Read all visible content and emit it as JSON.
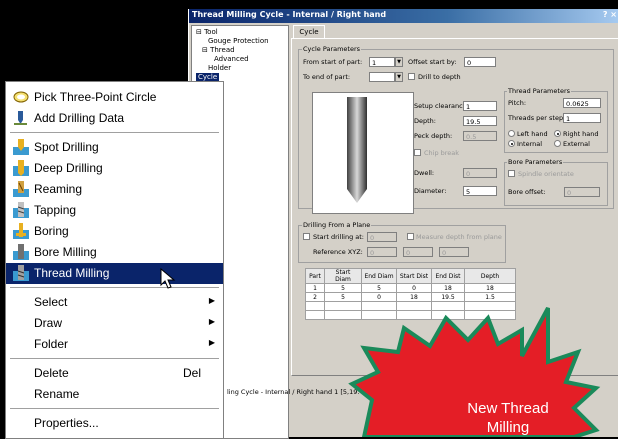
{
  "dialog": {
    "title": "Thread Milling Cycle - Internal / Right hand",
    "title_controls": "? ×",
    "tab_cycle": "Cycle",
    "tree": [
      {
        "label": "Tool"
      },
      {
        "label": "Gouge Protection"
      },
      {
        "label": "Thread"
      },
      {
        "label": "Advanced"
      },
      {
        "label": "Holder"
      },
      {
        "label": "Cycle",
        "selected": true
      }
    ],
    "cycle_parameters": {
      "group_title": "Cycle Parameters",
      "from_start_label": "From start of part:",
      "from_start_value": "1",
      "to_end_label": "To end of part:",
      "to_end_value": "",
      "offset_label": "Offset start by:",
      "offset_value": "0",
      "drill_to_depth_label": "Drill to depth",
      "setup_clearance_label": "Setup clearance:",
      "setup_clearance_value": "1",
      "depth_label": "Depth:",
      "depth_value": "19.5",
      "peck_depth_label": "Peck depth:",
      "peck_depth_value": "0.5",
      "chip_break_label": "Chip break",
      "dwell_label": "Dwell:",
      "dwell_value": "0",
      "diameter_label": "Diameter:",
      "diameter_value": "5"
    },
    "thread_parameters": {
      "group_title": "Thread Parameters",
      "pitch_label": "Pitch:",
      "pitch_value": "0.0625",
      "threads_per_step_label": "Threads per step:",
      "threads_per_step_value": "1",
      "left_hand_label": "Left hand",
      "right_hand_label": "Right hand",
      "internal_label": "Internal",
      "external_label": "External"
    },
    "bore_parameters": {
      "group_title": "Bore Parameters",
      "spindle_orientate_label": "Spindle orientate",
      "bore_offset_label": "Bore offset:",
      "bore_offset_value": "0"
    },
    "drilling_plane": {
      "group_title": "Drilling From a Plane",
      "start_drilling_label": "Start drilling at:",
      "start_drilling_value": "0",
      "measure_label": "Measure depth from plane",
      "reference_label": "Reference XYZ:",
      "ref_x": "0",
      "ref_y": "0",
      "ref_z": "0"
    },
    "table": {
      "headers": [
        "Part",
        "Start Diam",
        "End Diam",
        "Start Dist",
        "End Dist",
        "Depth"
      ],
      "rows": [
        [
          "1",
          "5",
          "5",
          "0",
          "18",
          "18"
        ],
        [
          "2",
          "5",
          "0",
          "18",
          "19.5",
          "1.5"
        ]
      ]
    },
    "statusbar": "ling Cycle - Internal / Right hand 1 [5,19."
  },
  "menu": {
    "items": [
      {
        "label": "Pick Three-Point Circle",
        "icon": "circle-icon"
      },
      {
        "label": "Add Drilling Data",
        "icon": "add-drill-icon"
      },
      {
        "label": "Spot Drilling",
        "icon": "spot-drill-icon"
      },
      {
        "label": "Deep Drilling",
        "icon": "deep-drill-icon"
      },
      {
        "label": "Reaming",
        "icon": "ream-icon"
      },
      {
        "label": "Tapping",
        "icon": "tap-icon"
      },
      {
        "label": "Boring",
        "icon": "bore-icon"
      },
      {
        "label": "Bore Milling",
        "icon": "bore-mill-icon"
      },
      {
        "label": "Thread Milling",
        "icon": "thread-mill-icon",
        "highlighted": true
      },
      {
        "label": "Select",
        "submenu": true
      },
      {
        "label": "Draw",
        "submenu": true
      },
      {
        "label": "Folder",
        "submenu": true
      },
      {
        "label": "Delete",
        "shortcut": "Del"
      },
      {
        "label": "Rename"
      },
      {
        "label": "Properties..."
      }
    ]
  },
  "callout": {
    "line1": "New Thread",
    "line2": "Milling",
    "color": "#e41e26",
    "border_color": "#1a8a5a"
  }
}
